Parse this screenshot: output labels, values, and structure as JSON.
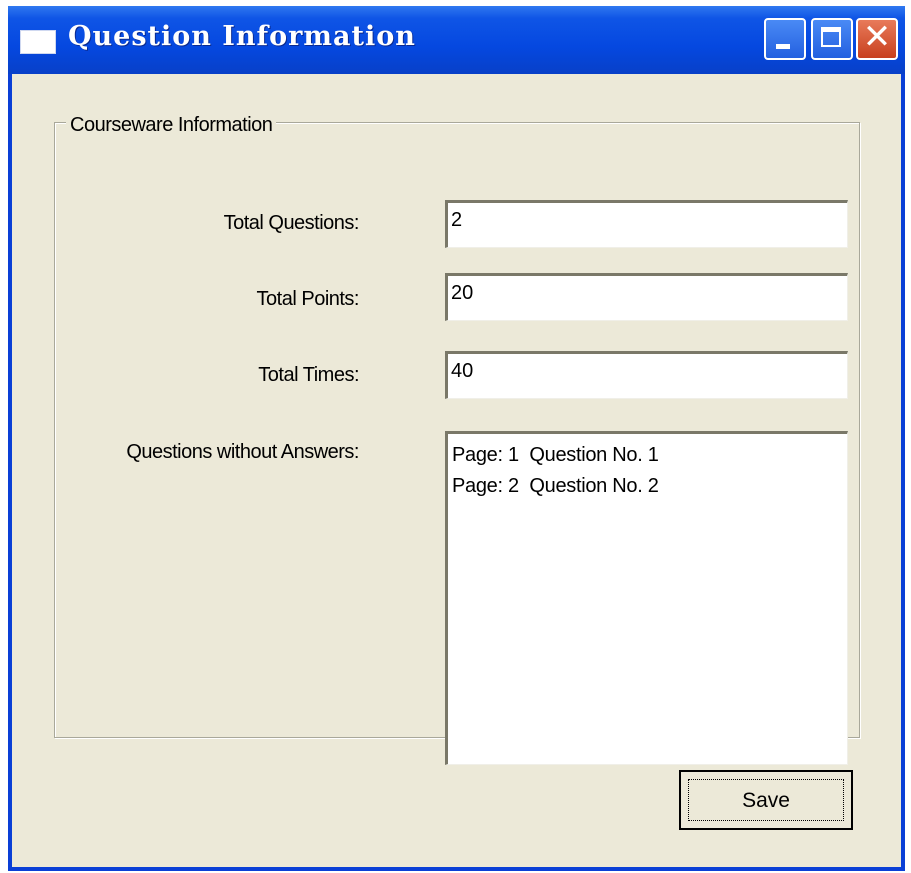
{
  "window": {
    "title": "Question Information"
  },
  "groupbox": {
    "legend": "Courseware Information"
  },
  "fields": {
    "total_questions": {
      "label": "Total Questions:",
      "value": "2"
    },
    "total_points": {
      "label": "Total Points:",
      "value": "20"
    },
    "total_times": {
      "label": "Total Times:",
      "value": "40"
    }
  },
  "unanswered": {
    "label": "Questions without Answers:",
    "items": [
      "Page: 1  Question No. 1",
      "Page: 2  Question No. 2"
    ]
  },
  "buttons": {
    "save_label": "Save"
  },
  "icons": {
    "window": "window-icon",
    "minimize": "minimize-icon",
    "maximize": "maximize-icon",
    "close": "close-icon"
  },
  "colors": {
    "titlebar": "#0548e0",
    "client_background": "#ece9d8",
    "close_button": "#c8401e"
  }
}
